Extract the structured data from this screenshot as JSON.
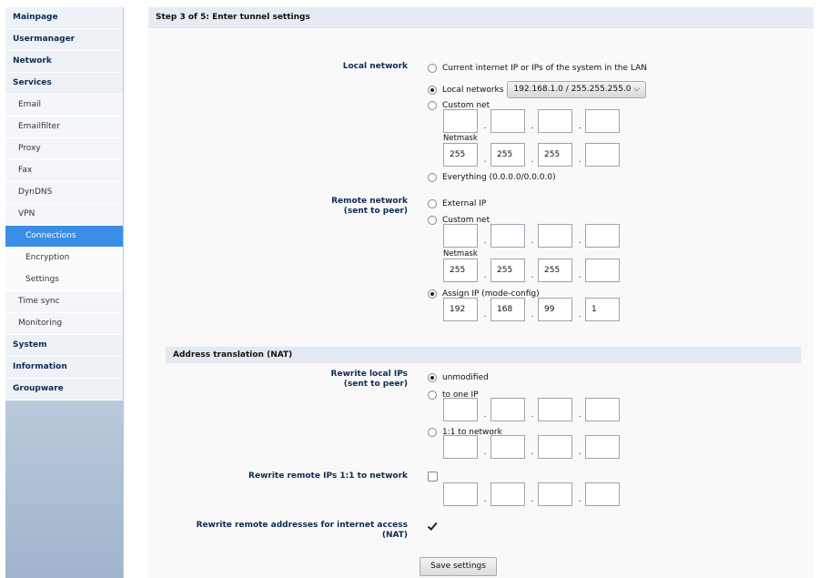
{
  "sidebar": {
    "items": [
      "Mainpage",
      "Usermanager",
      "Network",
      "Services"
    ],
    "services": [
      "Email",
      "Emailfilter",
      "Proxy",
      "Fax",
      "DynDNS",
      "VPN"
    ],
    "vpn": [
      "Connections",
      "Encryption",
      "Settings"
    ],
    "services_more": [
      "Time sync",
      "Monitoring"
    ],
    "bottom": [
      "System",
      "Information",
      "Groupware"
    ]
  },
  "header": {
    "title": "Step 3 of 5: Enter tunnel settings"
  },
  "local": {
    "label": "Local network",
    "opt_lan": "Current internet IP or IPs of the system in the LAN",
    "opt_localnets": "Local networks",
    "dropdown_value": "192.168.1.0 / 255.255.255.0",
    "opt_custom": "Custom net",
    "netmask": "Netmask",
    "mask": [
      "255",
      "255",
      "255",
      ""
    ],
    "opt_everything": "Everything (0.0.0.0/0.0.0.0)"
  },
  "remote": {
    "label": "Remote network",
    "label2": "(sent to peer)",
    "opt_external": "External IP",
    "opt_custom": "Custom net",
    "netmask": "Netmask",
    "mask": [
      "255",
      "255",
      "255",
      ""
    ],
    "opt_assign": "Assign IP (mode-config)",
    "assign_ip": [
      "192",
      "168",
      "99",
      "1"
    ]
  },
  "nat": {
    "section": "Address translation (NAT)",
    "rewrite_local": "Rewrite local IPs",
    "rewrite_local2": "(sent to peer)",
    "opt_unmodified": "unmodified",
    "opt_one_ip": "to one IP",
    "opt_network": "1:1 to network",
    "rewrite_remote": "Rewrite remote IPs 1:1 to network",
    "rewrite_internet": "Rewrite remote addresses for internet access",
    "rewrite_internet2": "(NAT)"
  },
  "save_label": "Save settings",
  "icons": {
    "dropdown": "chevron-down-icon",
    "checked": "checkmark-icon"
  }
}
